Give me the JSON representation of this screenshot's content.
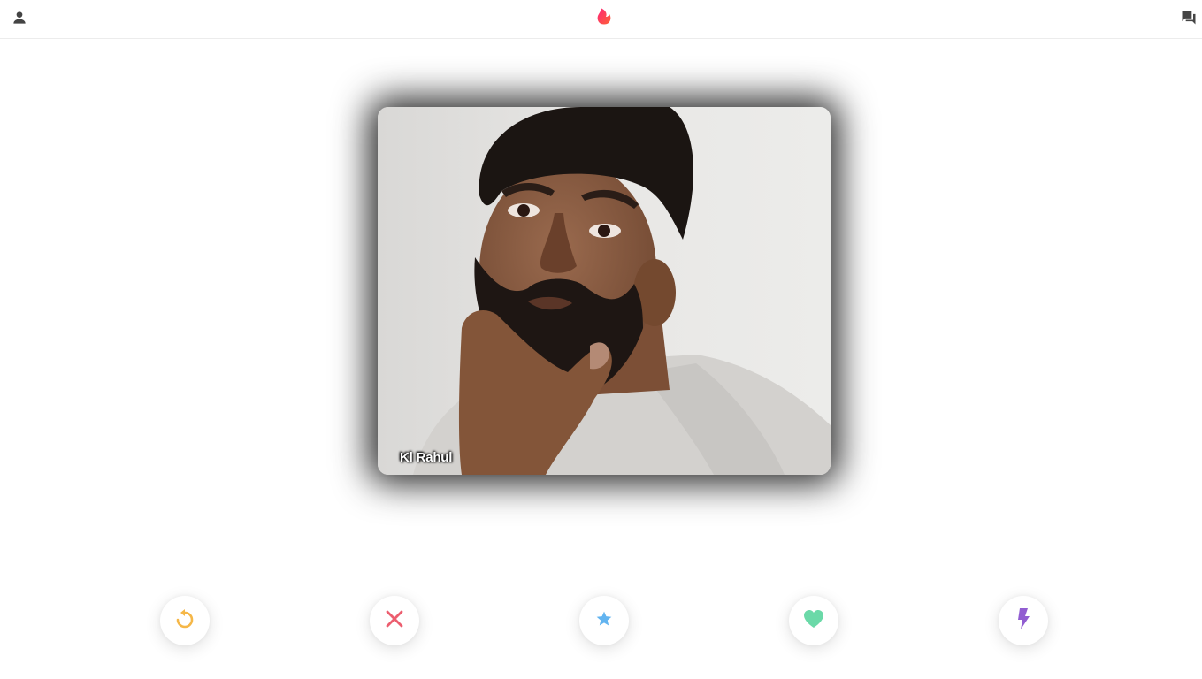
{
  "header": {
    "profile_icon": "person-icon",
    "logo_icon": "flame-icon",
    "messages_icon": "chat-icon",
    "brand_color": "#fe3c72"
  },
  "card": {
    "name": "Kl Rahul"
  },
  "actions": [
    {
      "name": "rewind",
      "icon": "rewind-icon",
      "color": "#f5b748"
    },
    {
      "name": "nope",
      "icon": "close-icon",
      "color": "#ec5e6f"
    },
    {
      "name": "super-like",
      "icon": "star-icon",
      "color": "#62b4f0"
    },
    {
      "name": "like",
      "icon": "heart-icon",
      "color": "#6bd9a8"
    },
    {
      "name": "boost",
      "icon": "bolt-icon",
      "color": "#915dd1"
    }
  ]
}
